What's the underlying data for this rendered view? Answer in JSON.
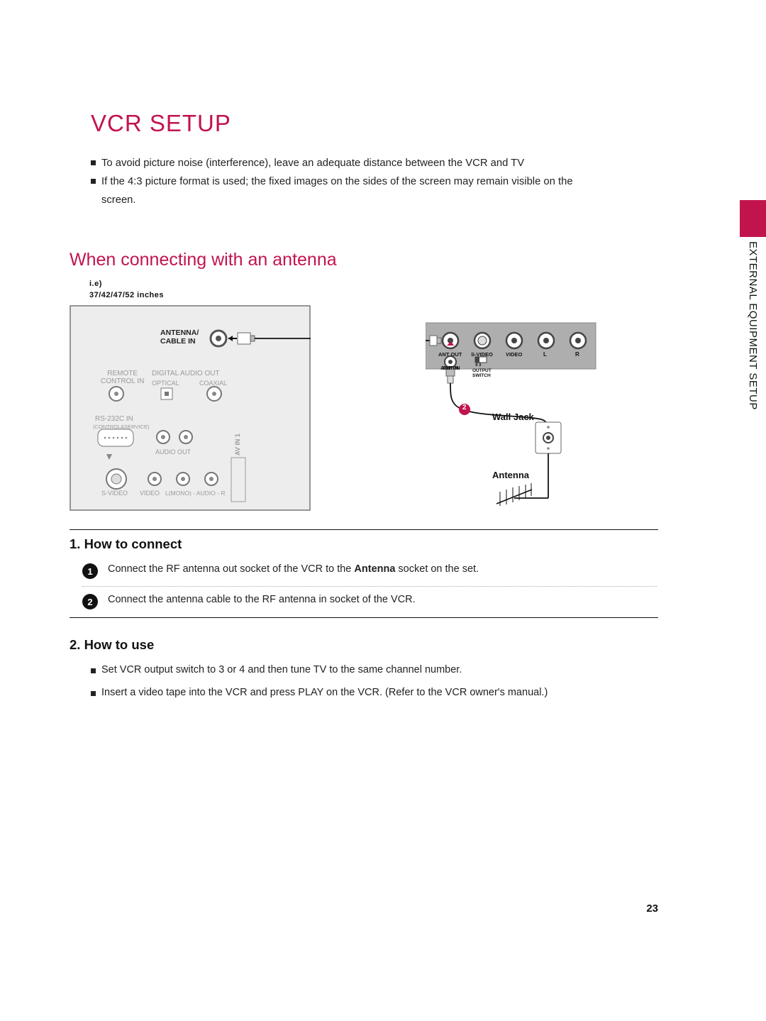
{
  "section_label": "EXTERNAL EQUIPMENT SETUP",
  "title": "VCR SETUP",
  "intro": {
    "bullet1": "To avoid picture noise (interference), leave an adequate distance between the VCR and TV",
    "bullet2": "If the 4:3 picture format is used; the fixed images on the sides of the screen may remain visible on the screen."
  },
  "subtitle": "When connecting with an antenna",
  "ie_note_line1": "i.e)",
  "ie_note_line2": "37/42/47/52 inches",
  "tv_panel": {
    "antenna_cable_in_1": "ANTENNA/",
    "antenna_cable_in_2": "CABLE IN",
    "remote": "REMOTE",
    "control_in": "CONTROL IN",
    "digital_audio": "DIGITAL AUDIO OUT",
    "optical": "OPTICAL",
    "coaxial": "COAXIAL",
    "rs232": "RS-232C IN",
    "rs232_sub": "(CONTROL&SERVICE)",
    "audio_out": "AUDIO OUT",
    "svideo": "S-VIDEO",
    "video": "VIDEO",
    "audio_lr": "L(MONO) - AUDIO - R",
    "avin": "AV IN 1"
  },
  "vcr_panel": {
    "ant_out": "ANT OUT",
    "svideo": "S-VIDEO",
    "video": "VIDEO",
    "L": "L",
    "R": "R",
    "ant_in": "ANT IN",
    "output_switch_1": "OUTPUT",
    "output_switch_2": "SWITCH",
    "switch_vals": "4    3"
  },
  "labels": {
    "wall_jack": "Wall Jack",
    "antenna": "Antenna"
  },
  "red_marker_1": "1",
  "red_marker_2": "2",
  "steps": {
    "heading": "1. How to connect",
    "s1_num": "1",
    "s1_text_a": "Connect the RF antenna out socket of the VCR to the ",
    "s1_text_bold": "Antenna",
    "s1_text_b": " socket on the set.",
    "s2_num": "2",
    "s2_text": "Connect the antenna cable to the RF antenna in socket of the VCR."
  },
  "use": {
    "heading": "2. How to use",
    "b1": "Set VCR output switch to 3 or 4 and then tune TV to the same channel number.",
    "b2": "Insert a video tape into the VCR and press PLAY on the VCR. (Refer to the VCR owner's manual.)"
  },
  "page_number": "23"
}
